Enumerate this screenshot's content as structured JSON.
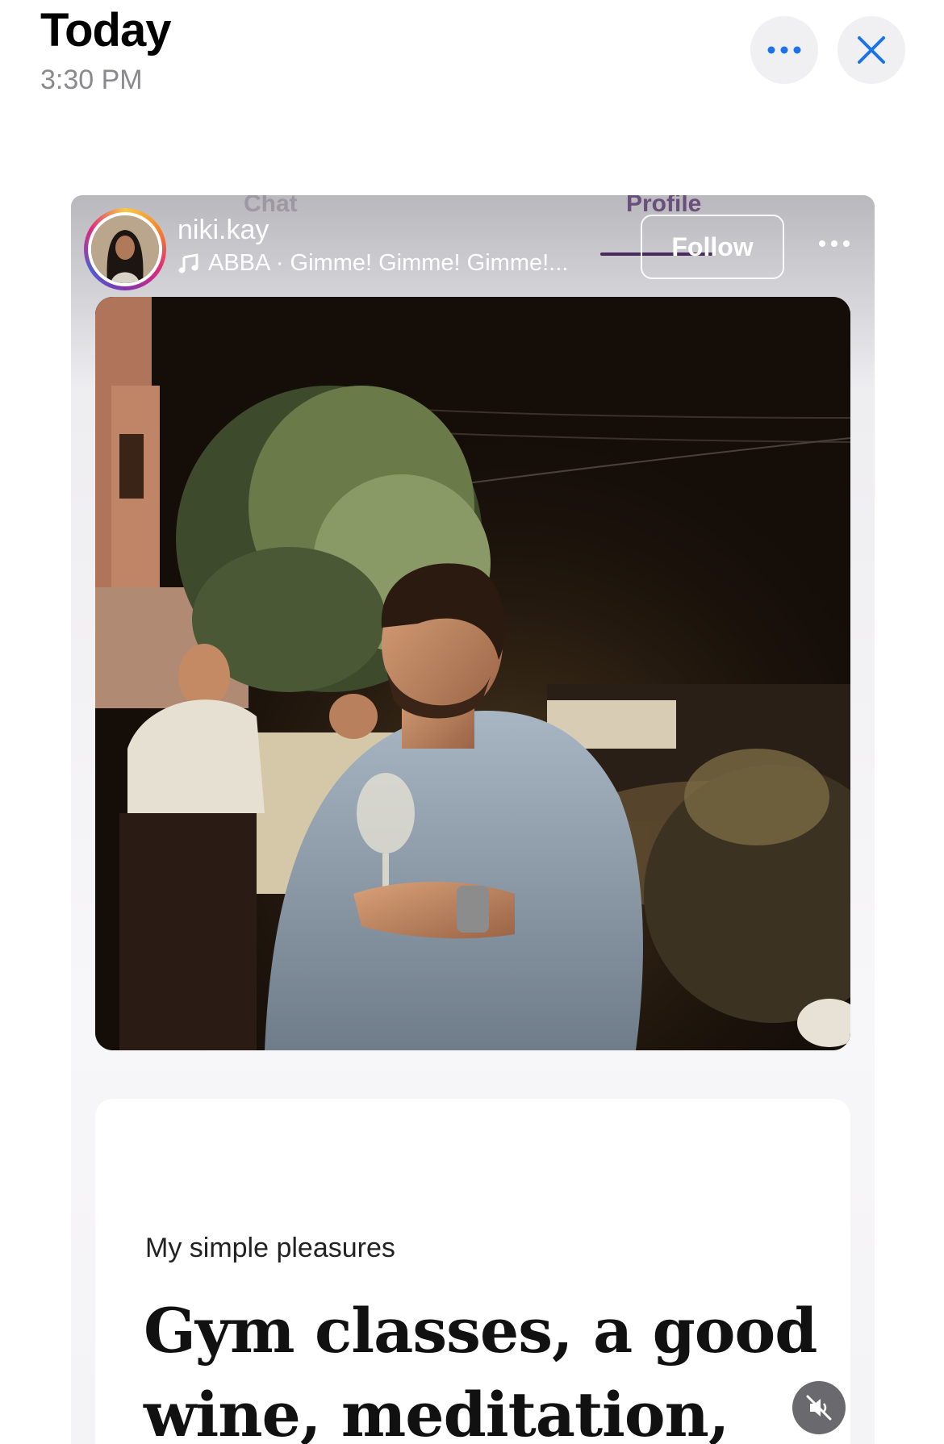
{
  "header": {
    "title": "Today",
    "time": "3:30 PM"
  },
  "story": {
    "ghost_tabs": {
      "chat": "Chat",
      "profile": "Profile"
    },
    "username": "niki.kay",
    "music": "ABBA · Gimme! Gimme! Gimme!...",
    "follow_label": "Follow",
    "section_label": "My simple pleasures",
    "pleasures_line1": "Gym classes, a good",
    "pleasures_line2": "wine, meditation,"
  },
  "icons": {
    "more": "more-dots-icon",
    "close": "close-x-icon",
    "music": "music-note-icon",
    "mute": "speaker-muted-icon"
  },
  "colors": {
    "accent_blue": "#1a73e8",
    "button_bg": "#f0f0f2",
    "ig_ring_start": "#f9c846",
    "ig_ring_mid": "#dd2a7b"
  }
}
